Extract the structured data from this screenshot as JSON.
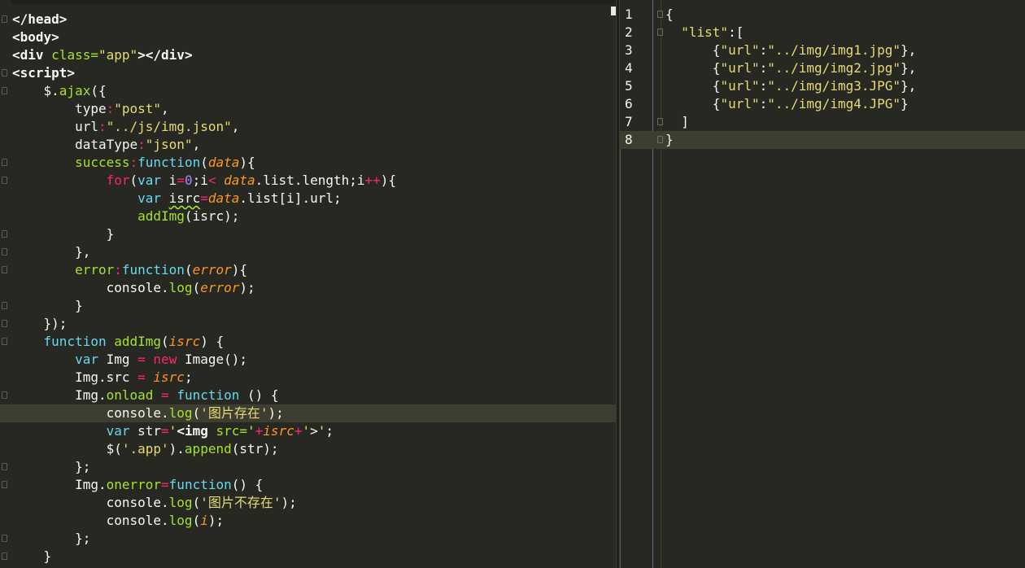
{
  "left_editor": {
    "lines": [
      {
        "tokens": [
          {
            "t": "</head>",
            "c": "tag"
          }
        ]
      },
      {
        "tokens": [
          {
            "t": "<body>",
            "c": "tag"
          }
        ]
      },
      {
        "tokens": [
          {
            "t": "<div ",
            "c": "tag"
          },
          {
            "t": "class=",
            "c": "attr"
          },
          {
            "t": "\"app\"",
            "c": "str"
          },
          {
            "t": "></div>",
            "c": "tag"
          }
        ]
      },
      {
        "tokens": [
          {
            "t": "<script>",
            "c": "tag"
          }
        ]
      },
      {
        "tokens": [
          {
            "t": "    $.",
            "c": "obj"
          },
          {
            "t": "ajax",
            "c": "fn"
          },
          {
            "t": "({",
            "c": "obj"
          }
        ]
      },
      {
        "tokens": [
          {
            "t": "        type",
            "c": "obj"
          },
          {
            "t": ":",
            "c": "kw"
          },
          {
            "t": "\"post\"",
            "c": "str"
          },
          {
            "t": ",",
            "c": "obj"
          }
        ]
      },
      {
        "tokens": [
          {
            "t": "        url",
            "c": "obj"
          },
          {
            "t": ":",
            "c": "kw"
          },
          {
            "t": "\"../js/img.json\"",
            "c": "str"
          },
          {
            "t": ",",
            "c": "obj"
          }
        ]
      },
      {
        "tokens": [
          {
            "t": "        dataType",
            "c": "obj"
          },
          {
            "t": ":",
            "c": "kw"
          },
          {
            "t": "\"json\"",
            "c": "str"
          },
          {
            "t": ",",
            "c": "obj"
          }
        ]
      },
      {
        "tokens": [
          {
            "t": "        success",
            "c": "fn"
          },
          {
            "t": ":",
            "c": "kw"
          },
          {
            "t": "function",
            "c": "fnkw"
          },
          {
            "t": "(",
            "c": "obj"
          },
          {
            "t": "data",
            "c": "arg"
          },
          {
            "t": "){",
            "c": "obj"
          }
        ]
      },
      {
        "tokens": [
          {
            "t": "            ",
            "c": "obj"
          },
          {
            "t": "for",
            "c": "kw"
          },
          {
            "t": "(",
            "c": "obj"
          },
          {
            "t": "var",
            "c": "fnkw"
          },
          {
            "t": " i",
            "c": "obj"
          },
          {
            "t": "=",
            "c": "kw"
          },
          {
            "t": "0",
            "c": "num"
          },
          {
            "t": ";i",
            "c": "obj"
          },
          {
            "t": "< ",
            "c": "kw"
          },
          {
            "t": "data",
            "c": "arg"
          },
          {
            "t": ".list.length;i",
            "c": "obj"
          },
          {
            "t": "++",
            "c": "kw"
          },
          {
            "t": "){",
            "c": "obj"
          }
        ]
      },
      {
        "tokens": [
          {
            "t": "                ",
            "c": "obj"
          },
          {
            "t": "var",
            "c": "fnkw"
          },
          {
            "t": " ",
            "c": "obj"
          },
          {
            "t": "isrc",
            "c": "squig"
          },
          {
            "t": "=",
            "c": "kw"
          },
          {
            "t": "data",
            "c": "arg"
          },
          {
            "t": ".list[i].url;",
            "c": "obj"
          }
        ]
      },
      {
        "tokens": [
          {
            "t": "                ",
            "c": "obj"
          },
          {
            "t": "addImg",
            "c": "fn"
          },
          {
            "t": "(isrc);",
            "c": "obj"
          }
        ]
      },
      {
        "tokens": [
          {
            "t": "            }",
            "c": "obj"
          }
        ]
      },
      {
        "tokens": [
          {
            "t": "        },",
            "c": "obj"
          }
        ]
      },
      {
        "tokens": [
          {
            "t": "        error",
            "c": "fn"
          },
          {
            "t": ":",
            "c": "kw"
          },
          {
            "t": "function",
            "c": "fnkw"
          },
          {
            "t": "(",
            "c": "obj"
          },
          {
            "t": "error",
            "c": "arg"
          },
          {
            "t": "){",
            "c": "obj"
          }
        ]
      },
      {
        "tokens": [
          {
            "t": "            console.",
            "c": "obj"
          },
          {
            "t": "log",
            "c": "fn"
          },
          {
            "t": "(",
            "c": "obj"
          },
          {
            "t": "error",
            "c": "arg"
          },
          {
            "t": ");",
            "c": "obj"
          }
        ]
      },
      {
        "tokens": [
          {
            "t": "        }",
            "c": "obj"
          }
        ]
      },
      {
        "tokens": [
          {
            "t": "    });",
            "c": "obj"
          }
        ]
      },
      {
        "tokens": [
          {
            "t": "    ",
            "c": "obj"
          },
          {
            "t": "function",
            "c": "fnkw"
          },
          {
            "t": " ",
            "c": "obj"
          },
          {
            "t": "addImg",
            "c": "fn"
          },
          {
            "t": "(",
            "c": "obj"
          },
          {
            "t": "isrc",
            "c": "arg"
          },
          {
            "t": ") {",
            "c": "obj"
          }
        ]
      },
      {
        "tokens": [
          {
            "t": "        ",
            "c": "obj"
          },
          {
            "t": "var",
            "c": "fnkw"
          },
          {
            "t": " Img ",
            "c": "obj"
          },
          {
            "t": "=",
            "c": "kw"
          },
          {
            "t": " ",
            "c": "obj"
          },
          {
            "t": "new",
            "c": "kw"
          },
          {
            "t": " Image();",
            "c": "obj"
          }
        ]
      },
      {
        "tokens": [
          {
            "t": "        Img.src ",
            "c": "obj"
          },
          {
            "t": "=",
            "c": "kw"
          },
          {
            "t": " ",
            "c": "obj"
          },
          {
            "t": "isrc",
            "c": "arg"
          },
          {
            "t": ";",
            "c": "obj"
          }
        ]
      },
      {
        "tokens": [
          {
            "t": "        Img.",
            "c": "obj"
          },
          {
            "t": "onload",
            "c": "fn"
          },
          {
            "t": " ",
            "c": "obj"
          },
          {
            "t": "=",
            "c": "kw"
          },
          {
            "t": " ",
            "c": "obj"
          },
          {
            "t": "function",
            "c": "fnkw"
          },
          {
            "t": " () {",
            "c": "obj"
          }
        ]
      },
      {
        "tokens": [
          {
            "t": "            console.",
            "c": "obj"
          },
          {
            "t": "log",
            "c": "fn"
          },
          {
            "t": "(",
            "c": "obj"
          },
          {
            "t": "'图片存在'",
            "c": "str"
          },
          {
            "t": ");",
            "c": "obj"
          }
        ],
        "active": true
      },
      {
        "tokens": [
          {
            "t": "            ",
            "c": "obj"
          },
          {
            "t": "var",
            "c": "fnkw"
          },
          {
            "t": " str",
            "c": "obj"
          },
          {
            "t": "=",
            "c": "kw"
          },
          {
            "t": "'",
            "c": "str"
          },
          {
            "t": "<img",
            "c": "tag"
          },
          {
            "t": " ",
            "c": "obj"
          },
          {
            "t": "src=",
            "c": "attr"
          },
          {
            "t": "'",
            "c": "str"
          },
          {
            "t": "+",
            "c": "kw"
          },
          {
            "t": "isrc",
            "c": "arg"
          },
          {
            "t": "+",
            "c": "kw"
          },
          {
            "t": "'",
            "c": "str"
          },
          {
            "t": ">",
            "c": "obj"
          },
          {
            "t": "'",
            "c": "str"
          },
          {
            "t": ";",
            "c": "obj"
          }
        ]
      },
      {
        "tokens": [
          {
            "t": "            $(",
            "c": "obj"
          },
          {
            "t": "'.app'",
            "c": "str"
          },
          {
            "t": ").",
            "c": "obj"
          },
          {
            "t": "append",
            "c": "fn"
          },
          {
            "t": "(str);",
            "c": "obj"
          }
        ]
      },
      {
        "tokens": [
          {
            "t": "        };",
            "c": "obj"
          }
        ]
      },
      {
        "tokens": [
          {
            "t": "        Img.",
            "c": "obj"
          },
          {
            "t": "onerror",
            "c": "fn"
          },
          {
            "t": "=",
            "c": "kw"
          },
          {
            "t": "function",
            "c": "fnkw"
          },
          {
            "t": "() {",
            "c": "obj"
          }
        ]
      },
      {
        "tokens": [
          {
            "t": "            console.",
            "c": "obj"
          },
          {
            "t": "log",
            "c": "fn"
          },
          {
            "t": "(",
            "c": "obj"
          },
          {
            "t": "'图片不存在'",
            "c": "str"
          },
          {
            "t": ");",
            "c": "obj"
          }
        ]
      },
      {
        "tokens": [
          {
            "t": "            console.",
            "c": "obj"
          },
          {
            "t": "log",
            "c": "fn"
          },
          {
            "t": "(",
            "c": "obj"
          },
          {
            "t": "i",
            "c": "arg"
          },
          {
            "t": ");",
            "c": "obj"
          }
        ]
      },
      {
        "tokens": [
          {
            "t": "        };",
            "c": "obj"
          }
        ]
      },
      {
        "tokens": [
          {
            "t": "    }",
            "c": "obj"
          }
        ]
      }
    ],
    "fold_rows": [
      0,
      3,
      4,
      8,
      9,
      12,
      13,
      14,
      16,
      17,
      18,
      21,
      25,
      26,
      29,
      30
    ]
  },
  "right_editor": {
    "lines": [
      {
        "num": "1",
        "tokens": [
          {
            "t": "{",
            "c": "rpunc"
          }
        ]
      },
      {
        "num": "2",
        "tokens": [
          {
            "t": "  ",
            "c": "rpunc"
          },
          {
            "t": "\"list\"",
            "c": "rkey"
          },
          {
            "t": ":[",
            "c": "rpunc"
          }
        ]
      },
      {
        "num": "3",
        "tokens": [
          {
            "t": "      {",
            "c": "rpunc"
          },
          {
            "t": "\"url\"",
            "c": "rkey"
          },
          {
            "t": ":",
            "c": "rpunc"
          },
          {
            "t": "\"../img/img1.jpg\"",
            "c": "rstr"
          },
          {
            "t": "},",
            "c": "rpunc"
          }
        ]
      },
      {
        "num": "4",
        "tokens": [
          {
            "t": "      {",
            "c": "rpunc"
          },
          {
            "t": "\"url\"",
            "c": "rkey"
          },
          {
            "t": ":",
            "c": "rpunc"
          },
          {
            "t": "\"../img/img2.jpg\"",
            "c": "rstr"
          },
          {
            "t": "},",
            "c": "rpunc"
          }
        ]
      },
      {
        "num": "5",
        "tokens": [
          {
            "t": "      {",
            "c": "rpunc"
          },
          {
            "t": "\"url\"",
            "c": "rkey"
          },
          {
            "t": ":",
            "c": "rpunc"
          },
          {
            "t": "\"../img/img3.JPG\"",
            "c": "rstr"
          },
          {
            "t": "},",
            "c": "rpunc"
          }
        ]
      },
      {
        "num": "6",
        "tokens": [
          {
            "t": "      {",
            "c": "rpunc"
          },
          {
            "t": "\"url\"",
            "c": "rkey"
          },
          {
            "t": ":",
            "c": "rpunc"
          },
          {
            "t": "\"../img/img4.JPG\"",
            "c": "rstr"
          },
          {
            "t": "}",
            "c": "rpunc"
          }
        ]
      },
      {
        "num": "7",
        "tokens": [
          {
            "t": "  ]",
            "c": "rpunc"
          }
        ]
      },
      {
        "num": "8",
        "tokens": [
          {
            "t": "}",
            "c": "rpunc"
          }
        ],
        "active": true
      }
    ],
    "fold_rows": [
      0,
      1,
      6,
      7
    ]
  }
}
